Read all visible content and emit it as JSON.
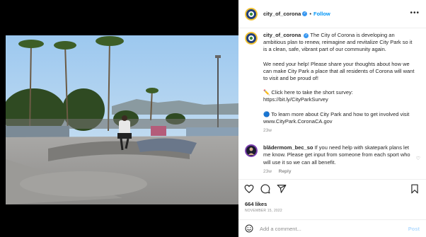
{
  "media": {
    "image_description_icon": "skatepark-photo"
  },
  "header": {
    "username": "city_of_corona",
    "separator": "•",
    "follow_label": "Follow",
    "more_icon": "more-horizontal-icon"
  },
  "caption": {
    "username": "city_of_corona",
    "paragraphs": [
      "The City of Corona is developing an ambitious plan to renew, reimagine and revitalize City Park so it is a clean, safe, vibrant part of our community again.",
      "We need your help! Please share your thoughts about how we can make City Park a place that all residents of Corona will want to visit and be proud of!",
      "✏️ Click here to take the short survey: https://bit.ly/CityParkSurvey",
      "🔵 To learn more about City Park and how to get involved visit www.CityPark.CoronaCA.gov"
    ],
    "time": "23w"
  },
  "comment": {
    "username": "blădermom_bec_so",
    "text": "If you need help with skatepark plans let me know. Please get input from someone from each sport who will use it so we can all benefit.",
    "time": "23w",
    "reply_label": "Reply"
  },
  "actions": {
    "likes": "664 likes",
    "date": "NOVEMBER 15, 2022"
  },
  "add_comment": {
    "placeholder": "Add a comment...",
    "post_label": "Post"
  },
  "colors": {
    "accent": "#0095f6",
    "verified": "#3897f0",
    "muted": "#8e8e8e"
  }
}
